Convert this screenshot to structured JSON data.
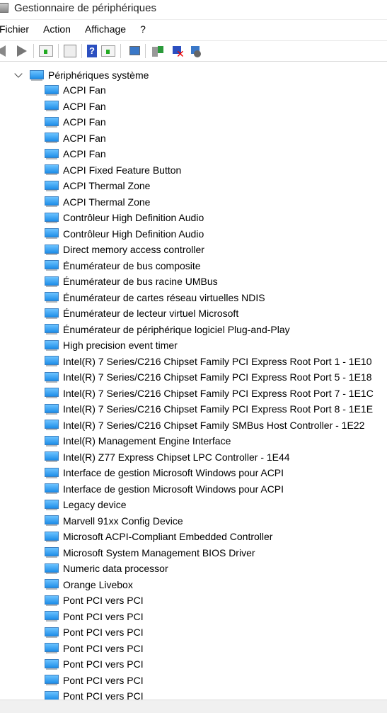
{
  "window": {
    "title": "Gestionnaire de périphériques"
  },
  "menu": [
    "Fichier",
    "Action",
    "Affichage",
    "?"
  ],
  "toolbar": [
    "back-icon",
    "forward-icon",
    "show-hide-console-tree-icon",
    "properties-icon",
    "help-icon",
    "show-action-pane-icon",
    "scan-hardware-icon",
    "update-driver-icon",
    "uninstall-device-icon",
    "disable-device-icon"
  ],
  "tree": {
    "root": "Périphériques système",
    "items": [
      "ACPI Fan",
      "ACPI Fan",
      "ACPI Fan",
      "ACPI Fan",
      "ACPI Fan",
      "ACPI Fixed Feature Button",
      "ACPI Thermal Zone",
      "ACPI Thermal Zone",
      "Contrôleur High Definition Audio",
      "Contrôleur High Definition Audio",
      "Direct memory access controller",
      "Énumérateur de bus composite",
      "Énumérateur de bus racine UMBus",
      "Énumérateur de cartes réseau virtuelles NDIS",
      "Énumérateur de lecteur virtuel Microsoft",
      "Énumérateur de périphérique logiciel Plug-and-Play",
      "High precision event timer",
      "Intel(R) 7 Series/C216 Chipset Family PCI Express Root Port 1 - 1E10",
      "Intel(R) 7 Series/C216 Chipset Family PCI Express Root Port 5 - 1E18",
      "Intel(R) 7 Series/C216 Chipset Family PCI Express Root Port 7 - 1E1C",
      "Intel(R) 7 Series/C216 Chipset Family PCI Express Root Port 8 - 1E1E",
      "Intel(R) 7 Series/C216 Chipset Family SMBus Host Controller - 1E22",
      "Intel(R) Management Engine Interface",
      "Intel(R) Z77 Express Chipset LPC Controller - 1E44",
      "Interface de gestion Microsoft Windows pour ACPI",
      "Interface de gestion Microsoft Windows pour ACPI",
      "Legacy device",
      "Marvell 91xx Config Device",
      "Microsoft ACPI-Compliant Embedded Controller",
      "Microsoft System Management BIOS Driver",
      "Numeric data processor",
      "Orange Livebox",
      "Pont PCI vers PCI",
      "Pont PCI vers PCI",
      "Pont PCI vers PCI",
      "Pont PCI vers PCI",
      "Pont PCI vers PCI",
      "Pont PCI vers PCI",
      "Pont PCI vers PCI"
    ]
  }
}
